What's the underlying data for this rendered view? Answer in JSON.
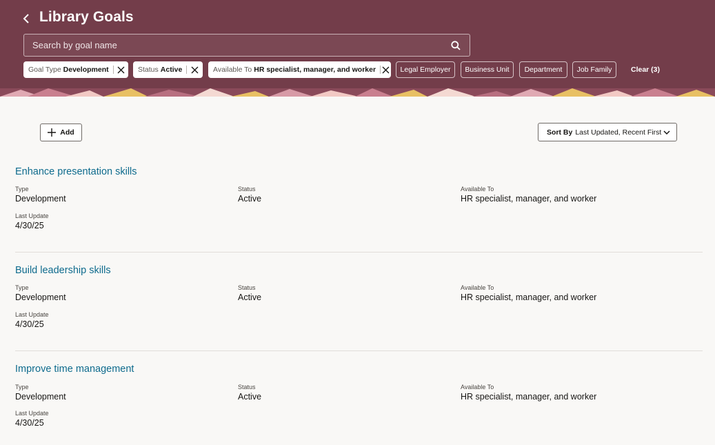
{
  "header": {
    "title": "Library Goals",
    "search_placeholder": "Search by goal name",
    "active_filters": [
      {
        "label": "Goal Type",
        "value": "Development"
      },
      {
        "label": "Status",
        "value": "Active"
      },
      {
        "label": "Available To",
        "value": "HR specialist, manager, and worker"
      }
    ],
    "filters": [
      "Legal Employer",
      "Business Unit",
      "Department",
      "Job Family"
    ],
    "clear_label": "Clear (3)",
    "colors": {
      "banner": "#733d4a",
      "accent_link": "#0e6b8d"
    }
  },
  "toolbar": {
    "add_label": "Add",
    "sort_label": "Sort By",
    "sort_value": "Last Updated, Recent First"
  },
  "goals": [
    {
      "name": "Enhance presentation skills",
      "type_label": "Type",
      "type": "Development",
      "status_label": "Status",
      "status": "Active",
      "available_label": "Available To",
      "available_to": "HR specialist, manager, and worker",
      "updated_label": "Last Update",
      "last_update": "4/30/25"
    },
    {
      "name": "Build leadership skills",
      "type_label": "Type",
      "type": "Development",
      "status_label": "Status",
      "status": "Active",
      "available_label": "Available To",
      "available_to": "HR specialist, manager, and worker",
      "updated_label": "Last Update",
      "last_update": "4/30/25"
    },
    {
      "name": "Improve time management",
      "type_label": "Type",
      "type": "Development",
      "status_label": "Status",
      "status": "Active",
      "available_label": "Available To",
      "available_to": "HR specialist, manager, and worker",
      "updated_label": "Last Update",
      "last_update": "4/30/25"
    }
  ]
}
